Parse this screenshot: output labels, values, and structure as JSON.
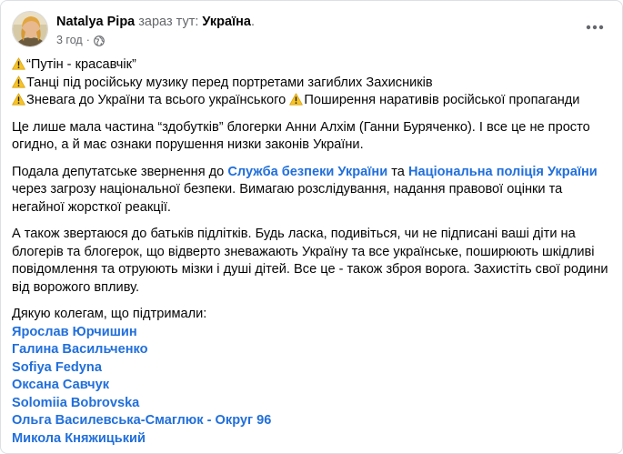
{
  "header": {
    "author": "Natalya Pipa",
    "location_prefix": "зараз тут:",
    "location": "Україна",
    "location_suffix": ".",
    "time": "3 год",
    "separator": "·",
    "privacy_icon": "globe-icon",
    "more_icon": "more-dots-icon"
  },
  "bullets": [
    "“Путін - красавчік”",
    "Танці під російську музику перед портретами загиблих Захисників",
    "Зневага до України та всього українського",
    "Поширення наративів російської пропаганди"
  ],
  "paragraph1": "Це лише мала частина “здобутків” блогерки Анни Алхім (Ганни Буряченко). І все це не просто огидно, а й має ознаки порушення низки законів України.",
  "paragraph2": {
    "before": "Подала депутатське звернення до ",
    "link1": "Служба безпеки України",
    "middle": " та ",
    "link2": "Національна поліція України",
    "after": " через загрозу національної безпеки. Вимагаю розслідування, надання правової оцінки та негайної жорсткої реакції."
  },
  "paragraph3": "А також звертаюся до батьків підлітків. Будь ласка, подивіться, чи не підписані ваші діти на блогерів та блогерок, що відверто зневажають Україну та все українське, поширюють шкідливі повідомлення та отруюють мізки і душі дітей. Все це - також зброя ворога. Захистіть свої родини від ворожого впливу.",
  "thanks_intro": "Дякую колегам, що підтримали:",
  "mentions": [
    "Ярослав Юрчишин",
    "Галина Васильченко",
    "Sofiya Fedyna",
    "Оксана Савчук",
    "Solomiia Bobrovska",
    "Ольга Василевська-Смаглюк - Округ 96",
    "Микола Княжицький"
  ],
  "colors": {
    "link": "#216fdb",
    "secondary_text": "#65676b",
    "warning_fill": "#f7c325"
  }
}
